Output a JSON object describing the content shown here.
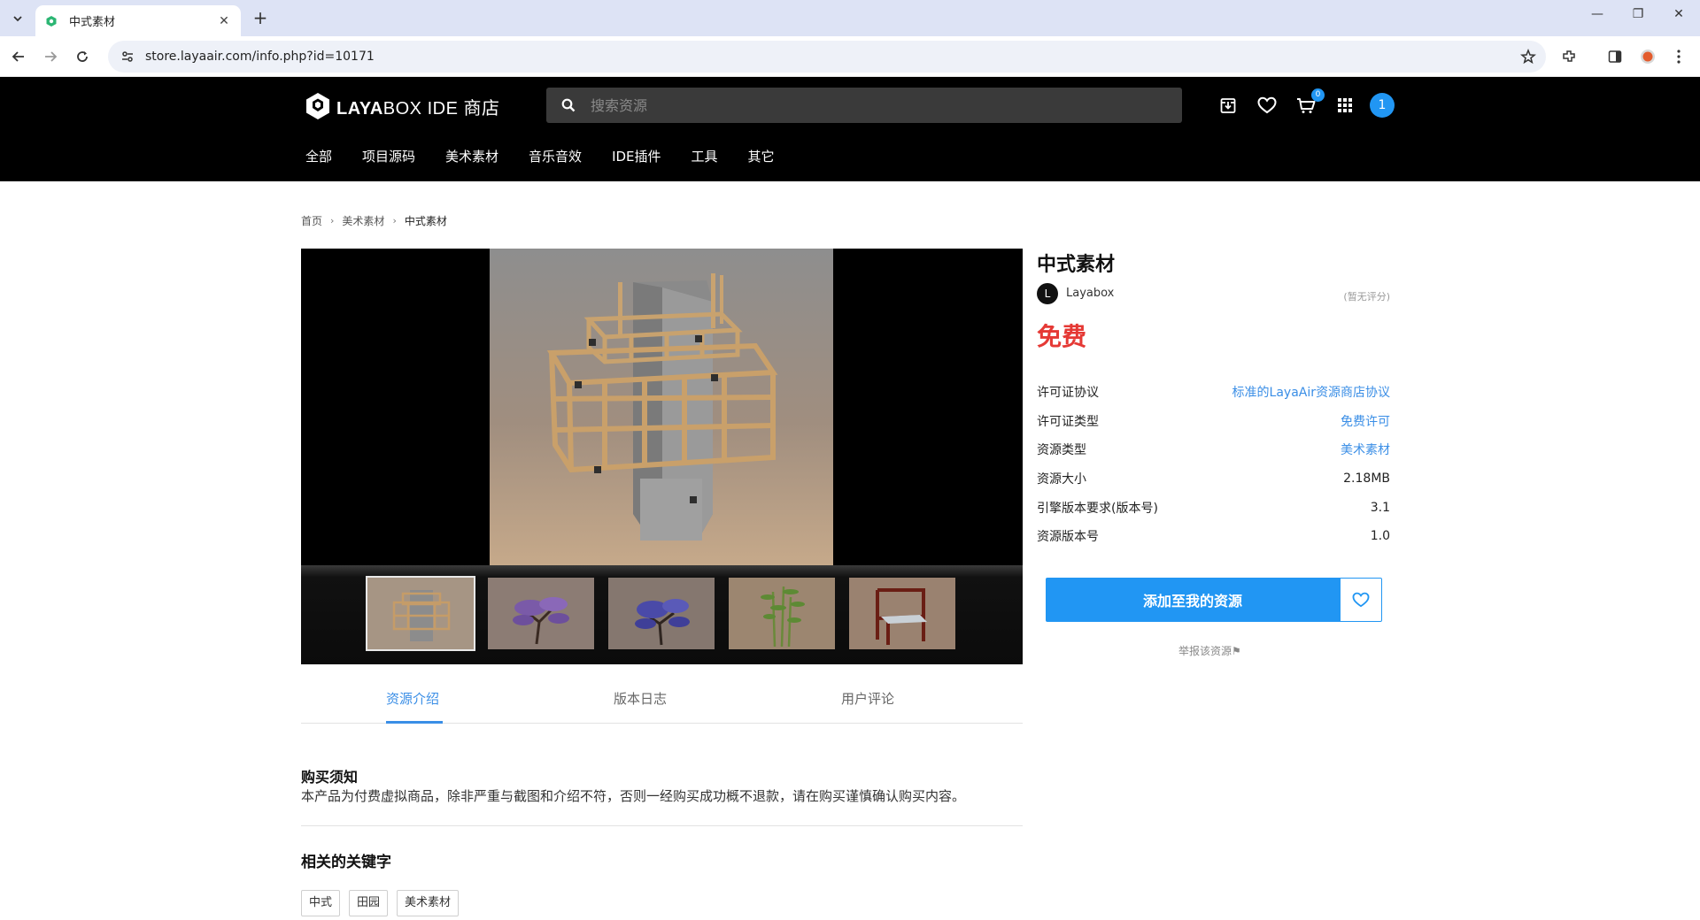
{
  "browser": {
    "tab_title": "中式素材",
    "url": "store.layaair.com/info.php?id=10171",
    "tab_close": "✕",
    "new_tab": "+",
    "window_controls": [
      "—",
      "❐",
      "✕"
    ]
  },
  "header": {
    "logo_strong": "LAYA",
    "logo_rest": "BOX IDE 商店",
    "search_placeholder": "搜索资源",
    "cart_count": "0",
    "user_avatar": "1",
    "nav": [
      "全部",
      "项目源码",
      "美术素材",
      "音乐音效",
      "IDE插件",
      "工具",
      "其它"
    ]
  },
  "breadcrumb": [
    "首页",
    "美术素材",
    "中式素材"
  ],
  "breadcrumb_sep": "›",
  "tabs": [
    "资源介绍",
    "版本日志",
    "用户评论"
  ],
  "notice": {
    "title": "购买须知",
    "text": "本产品为付费虚拟商品，除非严重与截图和介绍不符，否则一经购买成功概不退款，请在购买谨慎确认购买内容。"
  },
  "keywords": {
    "title": "相关的关键字",
    "items": [
      "中式",
      "田园",
      "美术素材"
    ]
  },
  "product": {
    "title": "中式素材",
    "author_initial": "L",
    "author": "Layabox",
    "rating": "(暂无评分)",
    "price": "免费",
    "specs": [
      {
        "label": "许可证协议",
        "value": "标准的LayaAir资源商店协议"
      },
      {
        "label": "许可证类型",
        "value": "免费许可"
      },
      {
        "label": "资源类型",
        "value": "美术素材"
      },
      {
        "label": "资源大小",
        "value": "2.18MB"
      },
      {
        "label": "引擎版本要求(版本号)",
        "value": "3.1"
      },
      {
        "label": "资源版本号",
        "value": "1.0"
      }
    ],
    "add_button": "添加至我的资源",
    "report": "举报该资源⚑"
  },
  "thumbnails": [
    "pavilion",
    "purple-tree",
    "blue-tree",
    "bamboo",
    "chair"
  ],
  "colors": {
    "accent": "#2196f3",
    "price": "#e53935",
    "link": "#3a8ee6"
  },
  "icons": [
    "menu-chevron-icon",
    "favicon-icon",
    "back-icon",
    "forward-icon",
    "reload-icon",
    "site-info-icon",
    "star-icon",
    "extensions-icon",
    "sidepanel-icon",
    "profile-icon",
    "more-icon",
    "search-icon",
    "download-icon",
    "heart-icon",
    "cart-icon",
    "apps-grid-icon"
  ]
}
